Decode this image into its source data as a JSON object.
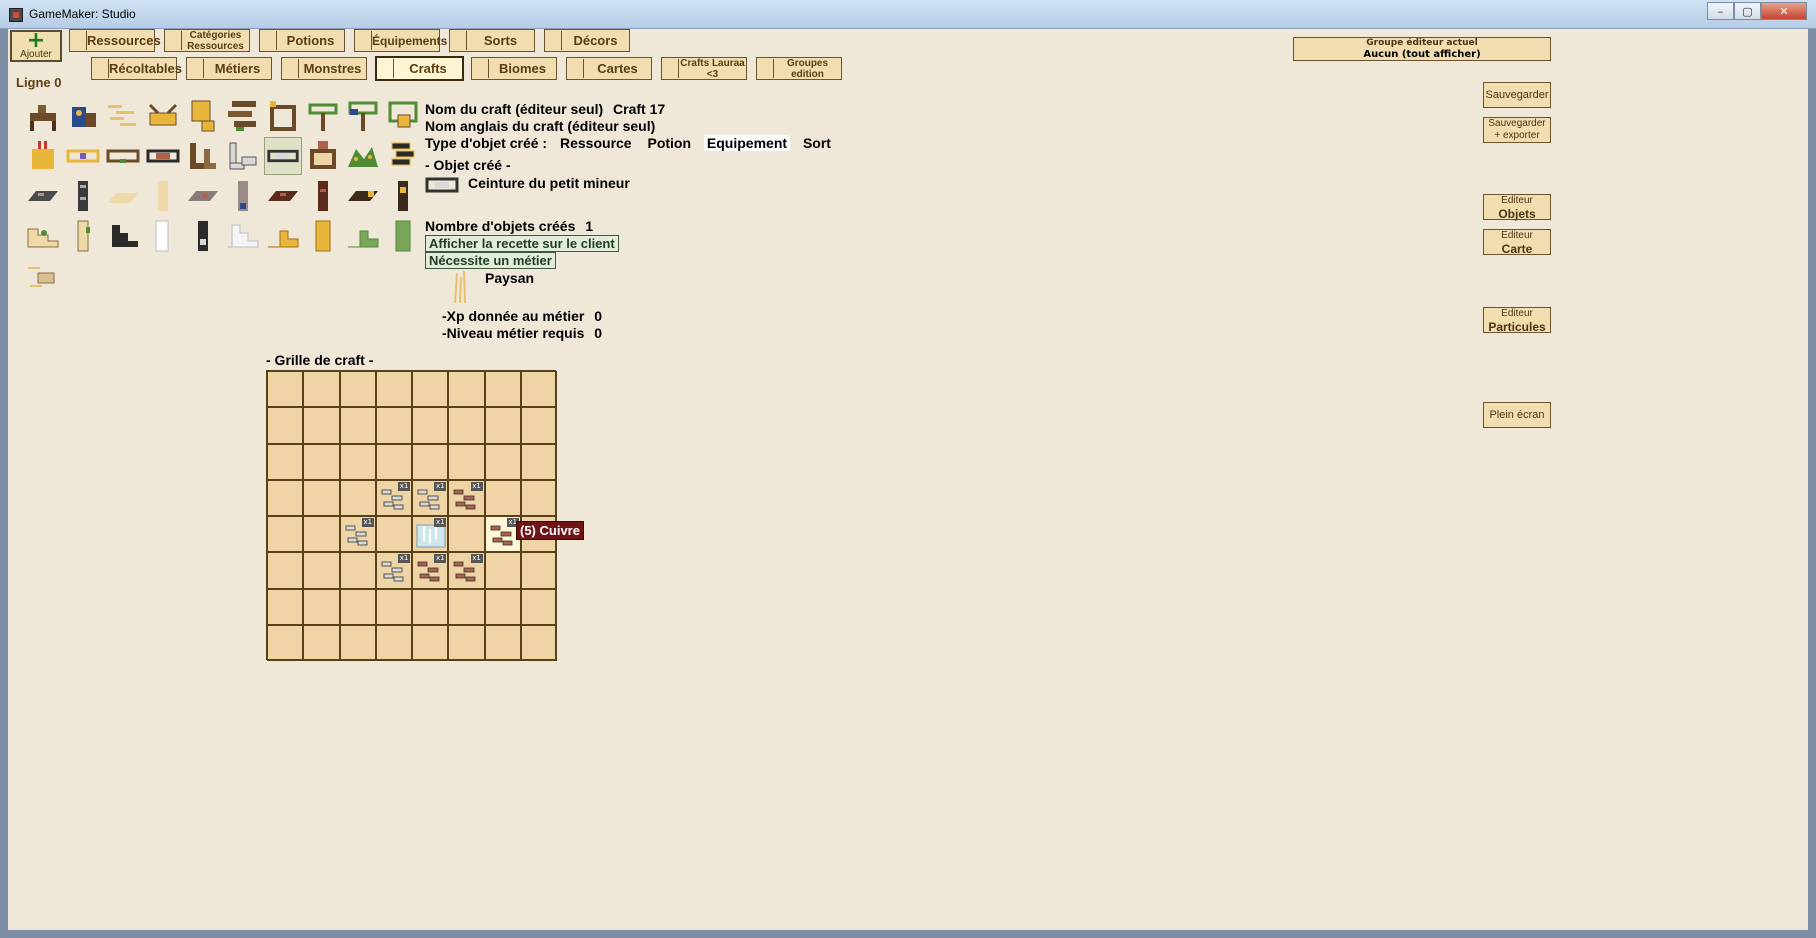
{
  "window": {
    "title": "GameMaker: Studio",
    "minimize": "–",
    "maximize": "▢",
    "close": "✕"
  },
  "toolbar": {
    "add_label": "Ajouter",
    "row_label": "Ligne 0",
    "row1": [
      "Ressources",
      "Catégories Ressources",
      "Potions",
      "Équipements",
      "Sorts",
      "Décors"
    ],
    "row2": [
      "Récoltables",
      "Métiers",
      "Monstres",
      "Crafts",
      "Biomes",
      "Cartes",
      "Crafts Lauraa <3",
      "Groupes edition"
    ],
    "selected": "Crafts"
  },
  "group": {
    "label": "Groupe éditeur actuel",
    "value": "Aucun (tout afficher)"
  },
  "side_buttons": {
    "save": "Sauvegarder",
    "save_export_1": "Sauvegarder",
    "save_export_2": "+ exporter",
    "editor_small": "Editeur",
    "objets": "Objets",
    "carte": "Carte",
    "particules": "Particules",
    "fullscreen": "Plein écran"
  },
  "form": {
    "name_label": "Nom du craft (éditeur seul)",
    "name_value": "Craft 17",
    "english_label": "Nom anglais du craft (éditeur seul)",
    "type_label": "Type d'objet créé :",
    "types": [
      "Ressource",
      "Potion",
      "Equipement",
      "Sort"
    ],
    "type_selected": "Equipement",
    "created_header": "- Objet créé -",
    "created_name": "Ceinture du petit mineur",
    "count_label": "Nombre d'objets créés",
    "count_value": "1",
    "show_recipe": "Afficher la recette sur le client",
    "needs_job": "Nécessite un métier",
    "job_name": "Paysan",
    "xp_label": "-Xp donnée au métier",
    "xp_value": "0",
    "level_label": "-Niveau métier requis",
    "level_value": "0"
  },
  "grid": {
    "title": "- Grille de craft -",
    "qty_badge": "x1",
    "tooltip": "(5) Cuivre",
    "items": [
      {
        "row": 3,
        "col": 3,
        "kind": "fer"
      },
      {
        "row": 3,
        "col": 4,
        "kind": "fer"
      },
      {
        "row": 3,
        "col": 5,
        "kind": "cuivre"
      },
      {
        "row": 4,
        "col": 2,
        "kind": "fer"
      },
      {
        "row": 4,
        "col": 4,
        "kind": "diamant"
      },
      {
        "row": 4,
        "col": 6,
        "kind": "cuivre"
      },
      {
        "row": 5,
        "col": 3,
        "kind": "fer"
      },
      {
        "row": 5,
        "col": 4,
        "kind": "cuivre"
      },
      {
        "row": 5,
        "col": 5,
        "kind": "cuivre"
      }
    ],
    "highlight": {
      "row": 4,
      "col": 6
    }
  },
  "colors": {
    "wood": "#6b4a2a",
    "leaf": "#4f8a35",
    "gold": "#e8b63a",
    "stone": "#4b4b4b",
    "copper": "#b0604a",
    "iron": "#d8d8d8"
  }
}
